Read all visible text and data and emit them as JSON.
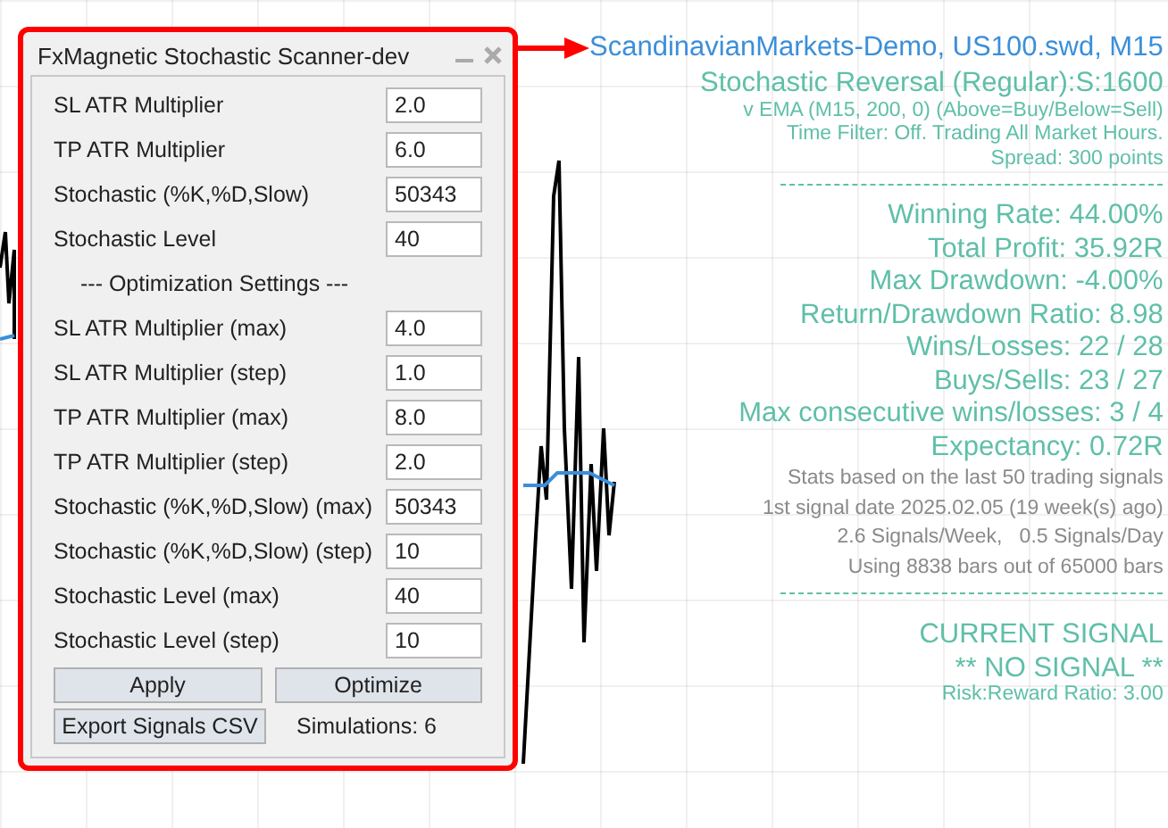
{
  "panel": {
    "title": "FxMagnetic Stochastic Scanner-dev",
    "rows": [
      {
        "kind": "field",
        "label": "SL ATR Multiplier",
        "value": "2.0"
      },
      {
        "kind": "field",
        "label": "TP ATR Multiplier",
        "value": "6.0"
      },
      {
        "kind": "field",
        "label": "Stochastic (%K,%D,Slow)",
        "value": "50343"
      },
      {
        "kind": "field",
        "label": "Stochastic Level",
        "value": "40"
      },
      {
        "kind": "heading",
        "label": "--- Optimization Settings ---"
      },
      {
        "kind": "field",
        "label": "SL ATR Multiplier (max)",
        "value": "4.0"
      },
      {
        "kind": "field",
        "label": "SL ATR Multiplier (step)",
        "value": "1.0"
      },
      {
        "kind": "field",
        "label": "TP ATR Multiplier (max)",
        "value": "8.0"
      },
      {
        "kind": "field",
        "label": "TP ATR Multiplier (step)",
        "value": "2.0"
      },
      {
        "kind": "field",
        "label": "Stochastic (%K,%D,Slow) (max)",
        "value": "50343"
      },
      {
        "kind": "field",
        "label": "Stochastic (%K,%D,Slow) (step)",
        "value": "10"
      },
      {
        "kind": "field",
        "label": "Stochastic Level (max)",
        "value": "40"
      },
      {
        "kind": "field",
        "label": "Stochastic Level (step)",
        "value": "10"
      }
    ],
    "apply_button": "Apply",
    "optimize_button": "Optimize",
    "export_button": "Export Signals CSV",
    "simulations": "Simulations: 6"
  },
  "info": [
    {
      "kind": "account",
      "text": "ScandinavianMarkets-Demo, US100.swd, M15"
    },
    {
      "kind": "large",
      "text": "Stochastic Reversal (Regular):S:1600"
    },
    {
      "kind": "small",
      "text": "v EMA (M15, 200, 0) (Above=Buy/Below=Sell)"
    },
    {
      "kind": "small",
      "text": "Time Filter: Off. Trading All Market Hours."
    },
    {
      "kind": "small",
      "text": "Spread: 300 points"
    },
    {
      "kind": "separator"
    },
    {
      "kind": "large",
      "text": "Winning Rate: 44.00%"
    },
    {
      "kind": "large",
      "text": "Total Profit: 35.92R"
    },
    {
      "kind": "large",
      "text": "Max Drawdown: -4.00%"
    },
    {
      "kind": "large",
      "text": "Return/Drawdown Ratio: 8.98"
    },
    {
      "kind": "large",
      "text": "Wins/Losses: 22 / 28"
    },
    {
      "kind": "large",
      "text": "Buys/Sells: 23 / 27"
    },
    {
      "kind": "large",
      "text": "Max consecutive wins/losses: 3 / 4"
    },
    {
      "kind": "large",
      "text": "Expectancy: 0.72R"
    },
    {
      "kind": "note",
      "text": "Stats based on the last 50 trading signals"
    },
    {
      "kind": "note",
      "text": "1st signal date 2025.02.05 (19 week(s) ago)"
    },
    {
      "kind": "note",
      "text": "2.6 Signals/Week,   0.5 Signals/Day"
    },
    {
      "kind": "note",
      "text": "Using 8838 bars out of 65000 bars"
    },
    {
      "kind": "separator"
    },
    {
      "kind": "spacer"
    },
    {
      "kind": "large",
      "text": "CURRENT SIGNAL"
    },
    {
      "kind": "large",
      "text": "** NO SIGNAL **"
    },
    {
      "kind": "small",
      "text": "Risk:Reward Ratio: 3.00"
    }
  ]
}
